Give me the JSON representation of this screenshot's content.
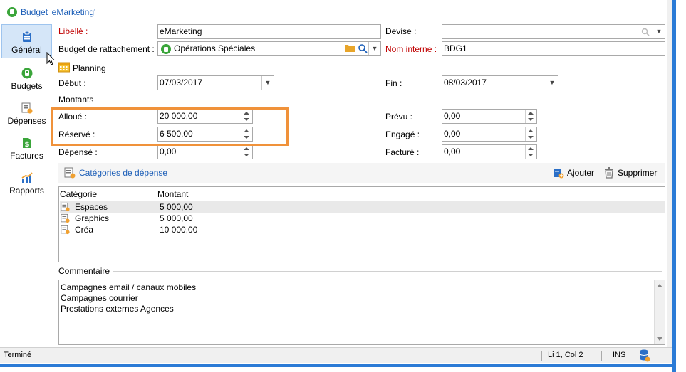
{
  "window": {
    "title": "Budget 'eMarketing'"
  },
  "sidebar": {
    "items": [
      {
        "label": "Général",
        "icon": "clipboard-icon"
      },
      {
        "label": "Budgets",
        "icon": "calculator-icon"
      },
      {
        "label": "Dépenses",
        "icon": "expense-doc-icon"
      },
      {
        "label": "Factures",
        "icon": "invoice-dollar-icon"
      },
      {
        "label": "Rapports",
        "icon": "chart-icon"
      }
    ]
  },
  "form": {
    "libelle_label": "Libellé :",
    "libelle_value": "eMarketing",
    "devise_label": "Devise :",
    "devise_value": "",
    "rattachement_label": "Budget de rattachement :",
    "rattachement_value": "Opérations Spéciales",
    "nom_interne_label": "Nom interne :",
    "nom_interne_value": "BDG1",
    "planning_title": "Planning",
    "debut_label": "Début :",
    "debut_value": "07/03/2017",
    "fin_label": "Fin :",
    "fin_value": "08/03/2017",
    "montants_title": "Montants",
    "alloue_label": "Alloué :",
    "alloue_value": "20 000,00",
    "reserve_label": "Réservé :",
    "reserve_value": "6 500,00",
    "depense_label": "Dépensé :",
    "depense_value": "0,00",
    "prevu_label": "Prévu :",
    "prevu_value": "0,00",
    "engage_label": "Engagé :",
    "engage_value": "0,00",
    "facture_label": "Facturé :",
    "facture_value": "0,00"
  },
  "categories": {
    "title": "Catégories de dépense",
    "add_label": "Ajouter",
    "delete_label": "Supprimer",
    "columns": [
      "Catégorie",
      "Montant"
    ],
    "rows": [
      {
        "categorie": "Espaces",
        "montant": "5 000,00"
      },
      {
        "categorie": "Graphics",
        "montant": "5 000,00"
      },
      {
        "categorie": "Créa",
        "montant": "10 000,00"
      }
    ]
  },
  "comment": {
    "title": "Commentaire",
    "lines": [
      "Campagnes email / canaux mobiles",
      "Campagnes courrier",
      "Prestations externes Agences"
    ]
  },
  "status": {
    "text": "Terminé",
    "position": "Li 1, Col 2",
    "mode": "INS"
  },
  "colors": {
    "accent": "#1d5fb8",
    "highlight": "#f0923a",
    "required": "#c00000",
    "selected_nav": "#d5e6f8"
  }
}
